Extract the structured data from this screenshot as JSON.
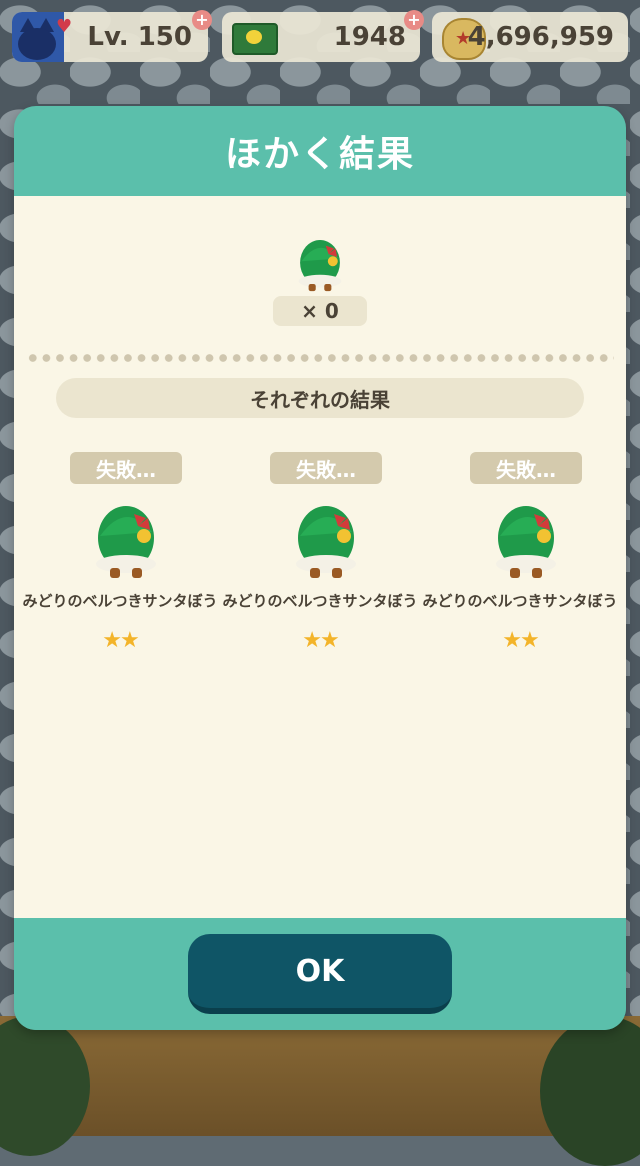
{
  "status_bar": {
    "level": "Lv. 150",
    "tickets": "1948",
    "bells": "4,696,959",
    "level_badge": "+",
    "tickets_badge": "+"
  },
  "dialog": {
    "title": "ほかく結果",
    "catch_quantity": "× 0",
    "section_header": "それぞれの結果",
    "results": [
      {
        "status": "失敗…",
        "item_name": "みどりのベルつきサンタぼう",
        "stars": "★★"
      },
      {
        "status": "失敗…",
        "item_name": "みどりのベルつきサンタぼう",
        "stars": "★★"
      },
      {
        "status": "失敗…",
        "item_name": "みどりのベルつきサンタぼう",
        "stars": "★★"
      }
    ],
    "ok_label": "OK"
  },
  "colors": {
    "dialog_header": "#5bbfab",
    "dialog_body": "#faf6e6",
    "ok_button": "#0f5566",
    "star": "#f3b42a",
    "hat_green": "#1f9a4a"
  },
  "icons": {
    "avatar": "cat-icon",
    "tickets": "ticket-icon",
    "bells": "bell-bag-icon",
    "item": "green-santa-hat-icon"
  }
}
